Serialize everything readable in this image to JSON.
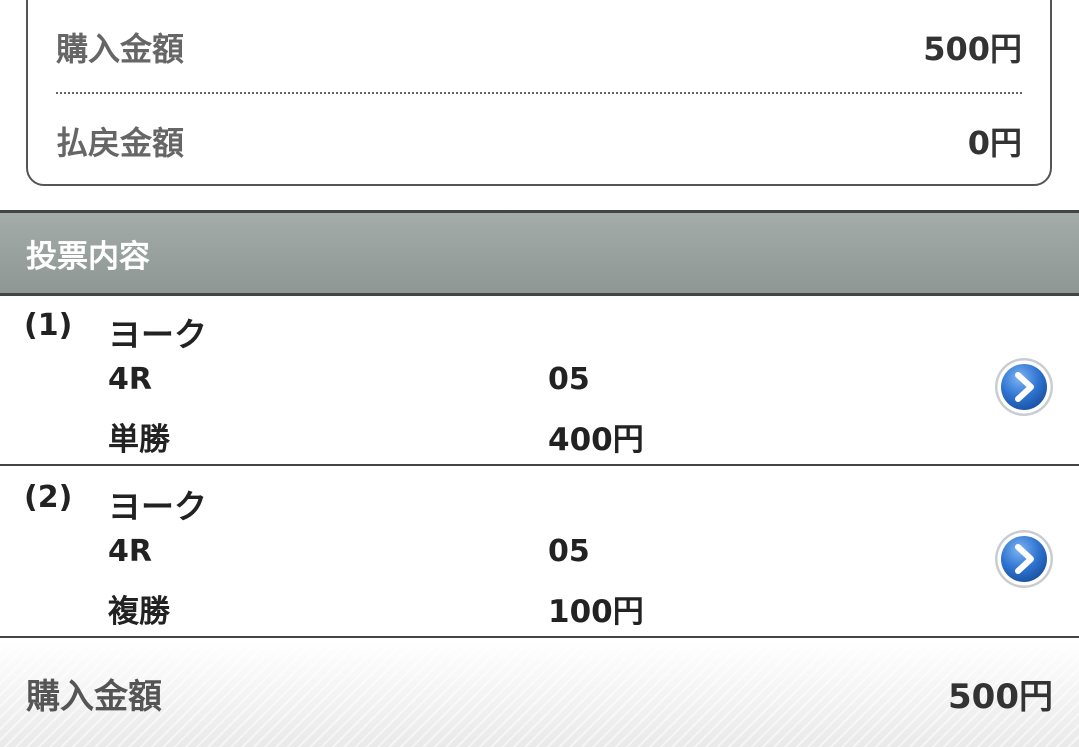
{
  "summary": {
    "purchase_label": "購入金額",
    "purchase_value": "500円",
    "refund_label": "払戻金額",
    "refund_value": "0円"
  },
  "section": {
    "title": "投票内容"
  },
  "bets": [
    {
      "number": "(1)",
      "venue": "ヨーク",
      "race": "4R",
      "combination": "05",
      "bet_type": "単勝",
      "amount": "400円"
    },
    {
      "number": "(2)",
      "venue": "ヨーク",
      "race": "4R",
      "combination": "05",
      "bet_type": "複勝",
      "amount": "100円"
    }
  ],
  "footer": {
    "total_label": "購入金額",
    "total_value": "500円"
  },
  "colors": {
    "header_bg": "#969e9b",
    "arrow_blue": "#2f74d0"
  },
  "icons": {
    "detail_arrow": "chevron-right-circle-icon"
  }
}
